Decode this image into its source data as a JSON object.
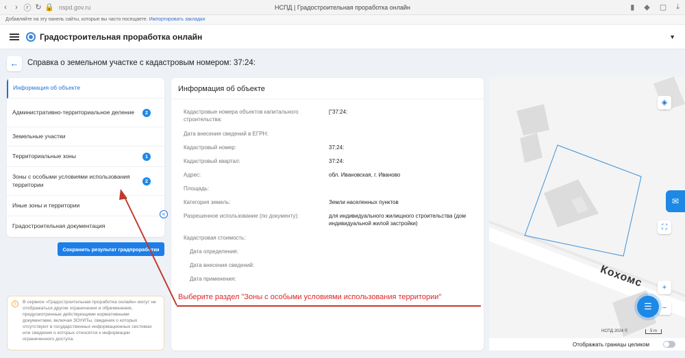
{
  "browser": {
    "url": "nspd.gov.ru",
    "tab_title": "НСПД | Градостроительная проработка онлайн",
    "bookmarks_text": "Добавляйте на эту панель сайты, которые вы часто посещаете.",
    "bookmarks_link": "Импортировать закладки"
  },
  "app": {
    "title": "Градостроительная проработка онлайн"
  },
  "page": {
    "title": "Справка о земельном участке с кадастровым номером: 37:24:"
  },
  "menu": {
    "items": [
      {
        "label": "Информация об объекте",
        "badge": ""
      },
      {
        "label": "Административно-территориальное деление",
        "badge": "2"
      },
      {
        "label": "Земельные участки",
        "badge": ""
      },
      {
        "label": "Территориальные зоны",
        "badge": "1"
      },
      {
        "label": "Зоны с особыми условиями использования территории",
        "badge": "2"
      },
      {
        "label": "Иные зоны и территории",
        "badge": ""
      },
      {
        "label": "Градостроительная документация",
        "badge": ""
      }
    ]
  },
  "save_button": "Сохранить результат градпроработки",
  "notice": "В сервисе «Градостроительная проработка онлайн» могут не отображаться другие ограничения и обременения, предусмотренные действующими нормативными документами, включая ЗОУИТы, сведения о которых отсутствуют в государственных информационных системах или сведения о которых относятся к информации ограниченного доступа.",
  "info": {
    "title": "Информация об объекте",
    "fields": [
      {
        "label": "Кадастровые номера объектов капитального строительства:",
        "value": "[\"37:24:"
      },
      {
        "label": "Дата внесения сведений в ЕГРН:",
        "value": ""
      },
      {
        "label": "Кадастровый номер:",
        "value": "37:24:"
      },
      {
        "label": "Кадастровый квартал:",
        "value": "37:24:"
      },
      {
        "label": "Адрес:",
        "value": "обл. Ивановская, г. Иваново"
      },
      {
        "label": "Площадь:",
        "value": ""
      },
      {
        "label": "Категория земель:",
        "value": "Земли населенных пунктов"
      },
      {
        "label": "Разрешенное использование (по документу):",
        "value": "для индивидуального жилищного строительства (дом индивидуальной жилой застройки)"
      }
    ],
    "cost_label": "Кадастровая стоимость:",
    "cost_fields": [
      "Дата определения:",
      "Дата внесения сведений:",
      "Дата применения:"
    ]
  },
  "annotation": "Выберите раздел \"Зоны с особыми условиями использования территории\"",
  "map": {
    "street_label": "Кохомс",
    "copyright": "НСПД 2024 ©",
    "scale": "5 m",
    "footer_label": "Отображать границы целиком",
    "zoom_in": "+",
    "zoom_out": "−"
  }
}
